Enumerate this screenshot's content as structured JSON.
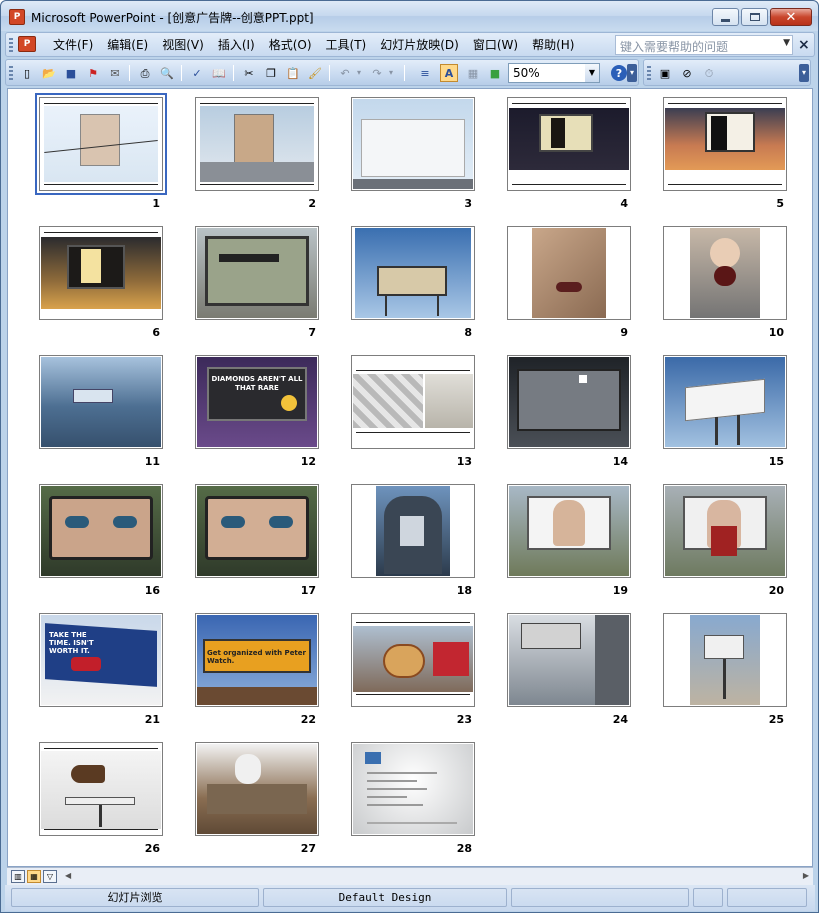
{
  "window": {
    "app_icon_glyph": "P",
    "title": "Microsoft PowerPoint - [创意广告牌--创意PPT.ppt]"
  },
  "menubar": {
    "doc_icon_glyph": "P",
    "items": [
      "文件(F)",
      "编辑(E)",
      "视图(V)",
      "插入(I)",
      "格式(O)",
      "工具(T)",
      "幻灯片放映(D)",
      "窗口(W)",
      "帮助(H)"
    ],
    "help_placeholder": "键入需要帮助的问题",
    "close_glyph": "×"
  },
  "toolbar": {
    "zoom_value": "50%",
    "icons": [
      "new-icon",
      "open-icon",
      "save-icon",
      "permission-icon",
      "email-icon",
      "print-icon",
      "print-preview-icon",
      "spelling-icon",
      "research-icon",
      "cut-icon",
      "copy-icon",
      "paste-icon",
      "format-painter-icon",
      "undo-icon",
      "redo-icon",
      "show-formatting-icon",
      "grayscale-icon",
      "grid-icon",
      "color-icon",
      "help-icon"
    ],
    "icon_glyphs": {
      "new": "▯",
      "open": "📂",
      "save": "■",
      "permission": "⚑",
      "email": "✉",
      "print": "⎙",
      "print_preview": "🔍",
      "spelling": "✓",
      "research": "📖",
      "cut": "✂",
      "copy": "❐",
      "paste": "📋",
      "format_painter": "🖌",
      "undo": "↶",
      "undo_drop": "▾",
      "redo": "↷",
      "redo_drop": "▾",
      "show_formatting": "≡",
      "grayscale": "A",
      "grid": "▦",
      "color": "■",
      "zoom_drop": "▼",
      "help": "?",
      "options": "▾",
      "slide_design": "▣",
      "hide_slide": "⊘",
      "rehearse": "⏱",
      "help_drop": "▾"
    }
  },
  "slides": [
    {
      "num": "1",
      "selected": true
    },
    {
      "num": "2"
    },
    {
      "num": "3"
    },
    {
      "num": "4"
    },
    {
      "num": "5"
    },
    {
      "num": "6"
    },
    {
      "num": "7"
    },
    {
      "num": "8"
    },
    {
      "num": "9"
    },
    {
      "num": "10"
    },
    {
      "num": "11"
    },
    {
      "num": "12"
    },
    {
      "num": "13"
    },
    {
      "num": "14"
    },
    {
      "num": "15"
    },
    {
      "num": "16"
    },
    {
      "num": "17"
    },
    {
      "num": "18"
    },
    {
      "num": "19"
    },
    {
      "num": "20"
    },
    {
      "num": "21"
    },
    {
      "num": "22"
    },
    {
      "num": "23"
    },
    {
      "num": "24"
    },
    {
      "num": "25"
    },
    {
      "num": "26"
    },
    {
      "num": "27"
    },
    {
      "num": "28"
    }
  ],
  "thumb_text": {
    "slide12": "DIAMONDS AREN'T ALL THAT RARE",
    "slide21": "TAKE THE TIME. ISN'T WORTH IT.",
    "slide22": "Get organized with Peter Watch."
  },
  "viewbar": {
    "normal_view_glyph": "▥",
    "sorter_view_glyph": "▦",
    "slideshow_view_glyph": "▽",
    "scroll_left_glyph": "◀",
    "scroll_right_glyph": "▶"
  },
  "statusbar": {
    "view": "幻灯片浏览",
    "design": "Default Design"
  },
  "colors": {
    "accent_selected": "#3a67c0",
    "title_bg": "#c5d8ee",
    "close_btn": "#c9462c"
  }
}
